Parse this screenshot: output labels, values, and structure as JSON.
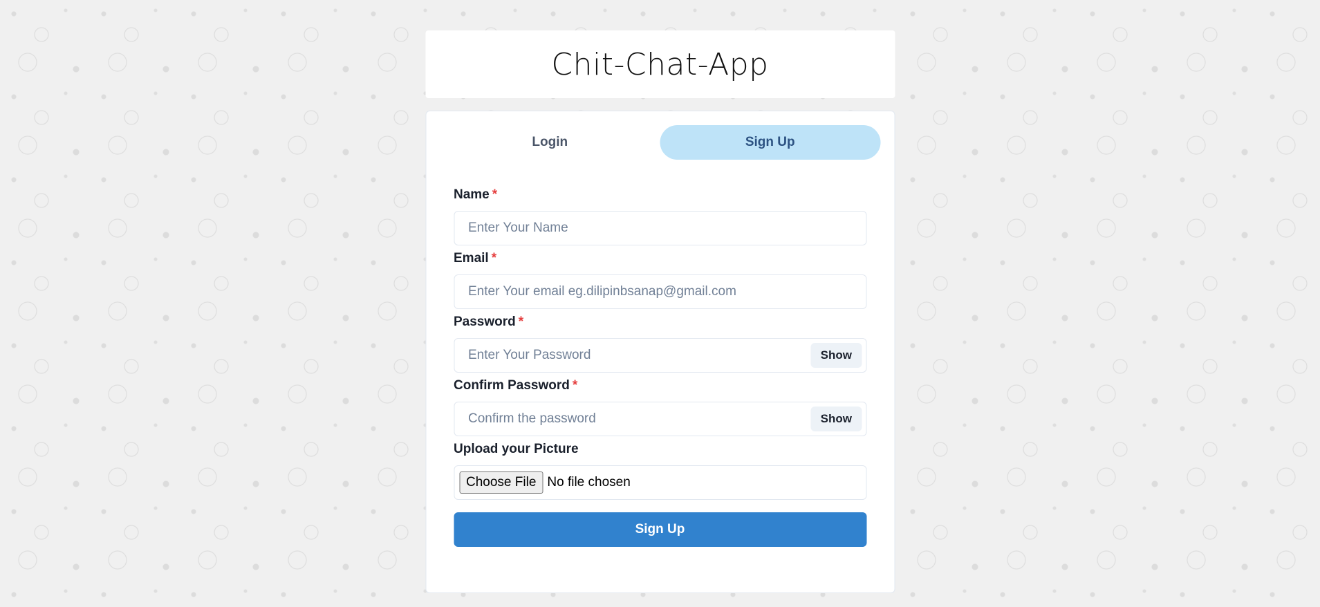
{
  "app": {
    "title": "Chit-Chat-App"
  },
  "tabs": [
    {
      "label": "Login",
      "active": false
    },
    {
      "label": "Sign Up",
      "active": true
    }
  ],
  "form": {
    "name": {
      "label": "Name",
      "required_mark": "*",
      "placeholder": "Enter Your Name",
      "value": ""
    },
    "email": {
      "label": "Email",
      "required_mark": "*",
      "placeholder": "Enter Your email eg.dilipinbsanap@gmail.com",
      "value": ""
    },
    "password": {
      "label": "Password",
      "required_mark": "*",
      "placeholder": "Enter Your Password",
      "value": "",
      "toggle_label": "Show"
    },
    "confirm_password": {
      "label": "Confirm Password",
      "required_mark": "*",
      "placeholder": "Confirm the password",
      "value": "",
      "toggle_label": "Show"
    },
    "picture": {
      "label": "Upload your Picture",
      "button_label": "Choose File",
      "status": "No file chosen"
    },
    "submit_label": "Sign Up"
  },
  "colors": {
    "active_tab_bg": "#bee3f8",
    "submit_bg": "#3182ce",
    "required_mark": "#e53e3e"
  }
}
